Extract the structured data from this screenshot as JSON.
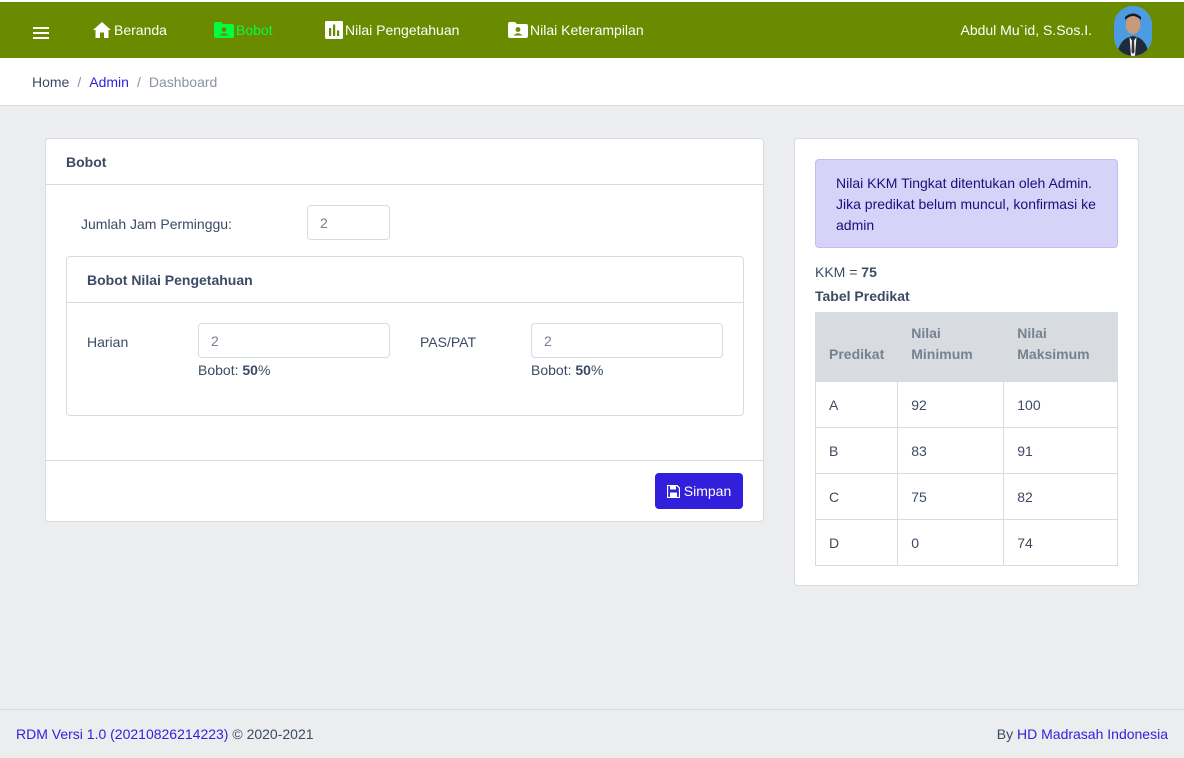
{
  "nav": {
    "items": [
      {
        "label": "Beranda",
        "icon": "home-icon"
      },
      {
        "label": "Bobot",
        "icon": "folder-user-icon",
        "active": true
      },
      {
        "label": "Nilai Pengetahuan",
        "icon": "bar-chart-icon"
      },
      {
        "label": "Nilai Keterampilan",
        "icon": "folder-user-icon"
      }
    ],
    "user_name": "Abdul Mu`id, S.Sos.I."
  },
  "breadcrumb": [
    "Home",
    "Admin",
    "Dashboard"
  ],
  "bobot_card": {
    "title": "Bobot",
    "jam_label": "Jumlah Jam Perminggu:",
    "jam_value": "2",
    "pengetahuan": {
      "title": "Bobot Nilai Pengetahuan",
      "harian_label": "Harian",
      "harian_value": "2",
      "harian_bobot_prefix": "Bobot: ",
      "harian_bobot_value": "50",
      "harian_bobot_suffix": "%",
      "pas_label": "PAS/PAT",
      "pas_value": "2",
      "pas_bobot_prefix": "Bobot: ",
      "pas_bobot_value": "50",
      "pas_bobot_suffix": "%"
    },
    "save_label": "Simpan"
  },
  "info_card": {
    "alert_text": "Nilai KKM Tingkat ditentukan oleh Admin. Jika predikat belum muncul, konfirmasi ke admin",
    "kkm_label": "KKM = ",
    "kkm_value": "75",
    "table_title": "Tabel Predikat",
    "columns": [
      "Predikat",
      "Nilai Minimum",
      "Nilai Maksimum"
    ],
    "rows": [
      [
        "A",
        "92",
        "100"
      ],
      [
        "B",
        "83",
        "91"
      ],
      [
        "C",
        "75",
        "82"
      ],
      [
        "D",
        "0",
        "74"
      ]
    ]
  },
  "footer": {
    "version_link": "RDM Versi 1.0 (20210826214223)",
    "copyright": " © 2020-2021",
    "by_prefix": "By ",
    "by_link": "HD Madrasah Indonesia"
  },
  "colors": {
    "topbar": "#6a8a00",
    "active_nav": "#00ff41",
    "primary": "#321fdb",
    "alert_bg": "#d6d2f8"
  }
}
